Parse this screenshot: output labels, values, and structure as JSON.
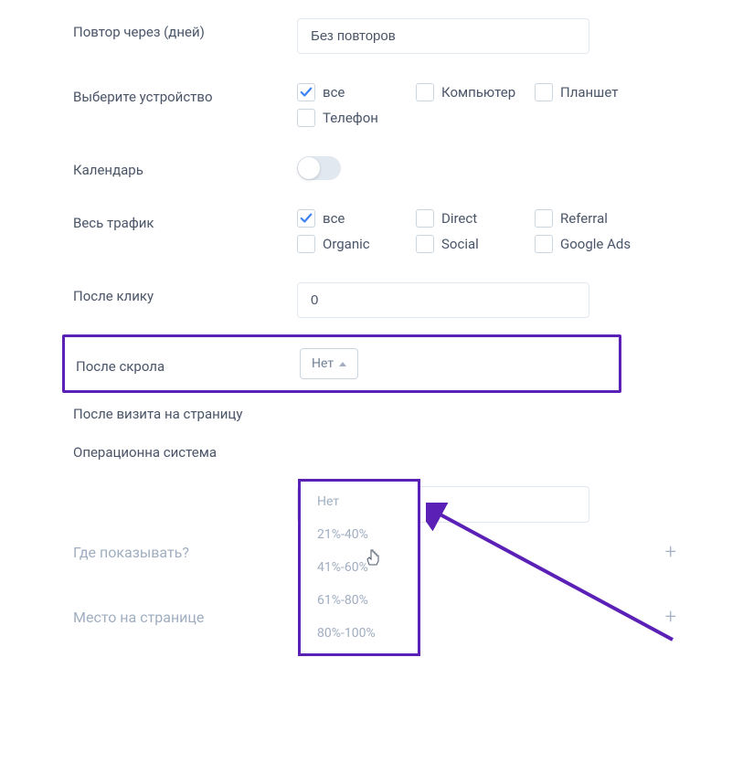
{
  "repeat": {
    "label": "Повтор через (дней)",
    "value": "Без повторов"
  },
  "device": {
    "label": "Выберите устройство",
    "options": [
      "все",
      "Компьютер",
      "Планшет",
      "Телефон"
    ],
    "checked": [
      true,
      false,
      false,
      false
    ]
  },
  "calendar": {
    "label": "Календарь",
    "enabled": false
  },
  "traffic": {
    "label": "Весь трафик",
    "options": [
      "все",
      "Direct",
      "Referral",
      "Organic",
      "Social",
      "Google Ads"
    ],
    "checked": [
      true,
      false,
      false,
      false,
      false,
      false
    ]
  },
  "afterClick": {
    "label": "После клику",
    "value": "0"
  },
  "afterScroll": {
    "label": "После скрола",
    "selected": "Нет",
    "options": [
      "Нет",
      "21%-40%",
      "41%-60%",
      "61%-80%",
      "80%-100%"
    ]
  },
  "afterVisit": {
    "label": "После визита на страницу"
  },
  "os": {
    "label": "Операционна система"
  },
  "accordion1": {
    "label": "Где показывать?"
  },
  "accordion2": {
    "label": "Место на странице"
  },
  "annotation": {
    "checkColor": "#3b82f6",
    "highlightColor": "#5b21b6"
  }
}
